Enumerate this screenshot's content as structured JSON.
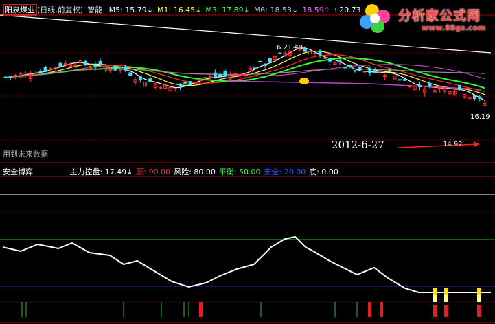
{
  "header": {
    "stock_name": "阳泉煤业",
    "period": "(日线,前复权)",
    "mode": "智能",
    "ma": [
      {
        "label": "M5:",
        "value": "15.79",
        "arrow": "↓",
        "color": "#ffffff"
      },
      {
        "label": "M1:",
        "value": "16.45",
        "arrow": "↓",
        "color": "#ffff40"
      },
      {
        "label": "M3:",
        "value": "17.89",
        "arrow": "↓",
        "color": "#40ff40"
      },
      {
        "label": "M6:",
        "value": "18.53",
        "arrow": "↓",
        "color": "#c0c0c0"
      },
      {
        "label": "",
        "value": "18.59",
        "arrow": "↑",
        "color": "#ff60ff"
      },
      {
        "label": ":",
        "value": "20.73",
        "arrow": "",
        "color": "#ffffff"
      }
    ]
  },
  "logo": {
    "title": "分析家公式网",
    "url": "www.88gs.com"
  },
  "main_chart": {
    "future_note": "用到未来数据",
    "date_label": "2012-6-27",
    "low_price": "14.92",
    "price_labels": [
      "6.21.49",
      "16.19"
    ]
  },
  "indicator": {
    "name": "安全博弈",
    "items": [
      {
        "label": "主力控盘:",
        "value": "17.49",
        "arrow": "↓",
        "color": "#ffffff"
      },
      {
        "label": "顶:",
        "value": "90.00",
        "arrow": "",
        "color": "#ff3030"
      },
      {
        "label": "风险:",
        "value": "80.00",
        "arrow": "",
        "color": "#ffffff"
      },
      {
        "label": "平衡:",
        "value": "50.00",
        "arrow": "",
        "color": "#40ff40"
      },
      {
        "label": "安全:",
        "value": "20.00",
        "arrow": "",
        "color": "#3050ff"
      },
      {
        "label": "底:",
        "value": "0.00",
        "arrow": "",
        "color": "#ffffff"
      }
    ]
  },
  "colors": {
    "up": "#ff3030",
    "down": "#40e0ff",
    "grid": "#800000",
    "white": "#ffffff"
  }
}
